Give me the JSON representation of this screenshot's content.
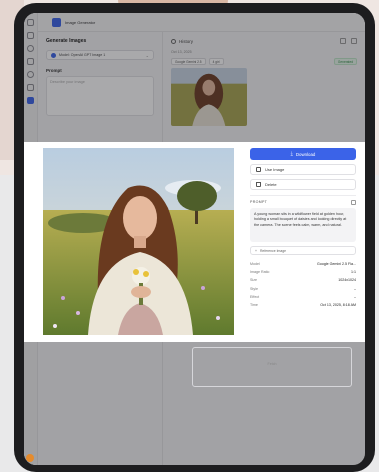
{
  "app": {
    "title": "Image Generator"
  },
  "generate": {
    "title": "Generate Images",
    "model_label": "Model: OpenAI GPT Image 1",
    "prompt_label": "Prompt",
    "prompt_placeholder": "Describe your image"
  },
  "history": {
    "title": "History",
    "date": "Oct 13, 2025",
    "model_chip": "Google Gemini 2.5",
    "format_chip": "4 girl",
    "status": "Generated",
    "bottom_label": "Fetch"
  },
  "modal": {
    "download_label": "Download",
    "use_image_label": "Use Image",
    "delete_label": "Delete",
    "prompt_heading": "PROMPT",
    "prompt_text": "A young woman sits in a wildflower field at golden hour, holding a small bouquet of daisies and looking directly at the camera. The scene feels calm, warm, and natural.",
    "reference_label": "Reference Image",
    "meta": [
      {
        "key": "Model",
        "value": "Google Gemini 2.5 Fla..."
      },
      {
        "key": "Image Ratio",
        "value": "1:1"
      },
      {
        "key": "Size",
        "value": "1024x1024"
      },
      {
        "key": "Style",
        "value": "–"
      },
      {
        "key": "Effect",
        "value": "–"
      },
      {
        "key": "Time",
        "value": "Oct 13, 2025, 8:18 AM"
      }
    ]
  }
}
